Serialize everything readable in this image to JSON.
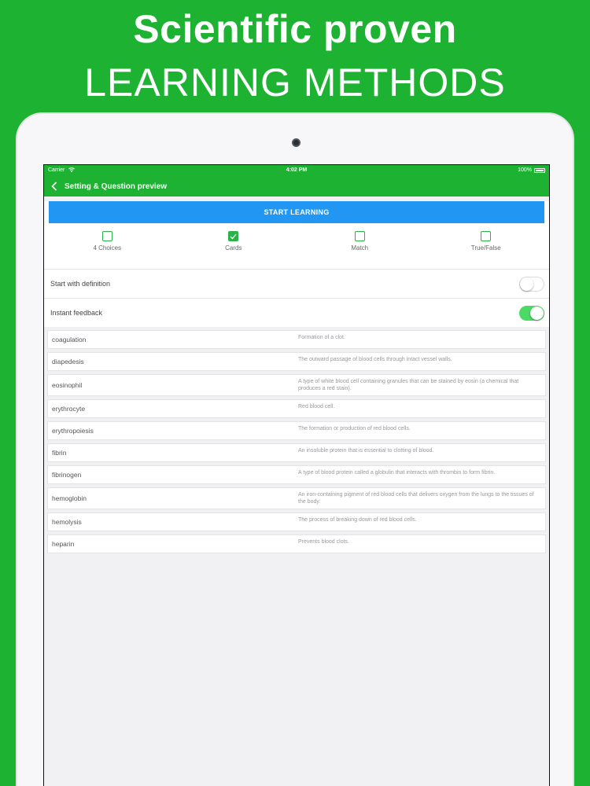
{
  "headline": {
    "line1": "Scientific proven",
    "line2": "LEARNING METHODS"
  },
  "status_bar": {
    "carrier": "Carrier",
    "time": "4:02 PM",
    "battery": "100%"
  },
  "nav": {
    "title": "Setting & Question preview"
  },
  "start_button": "START LEARNING",
  "modes": [
    {
      "label": "4 Choices",
      "checked": false
    },
    {
      "label": "Cards",
      "checked": true
    },
    {
      "label": "Match",
      "checked": false
    },
    {
      "label": "True/False",
      "checked": false
    }
  ],
  "settings": [
    {
      "label": "Start with definition",
      "on": false
    },
    {
      "label": "Instant feedback",
      "on": true
    }
  ],
  "terms": [
    {
      "term": "coagulation",
      "definition": "Formation of a clot."
    },
    {
      "term": "diapedesis",
      "definition": "The outward passage of blood cells through intact vessel walls."
    },
    {
      "term": "eosinophil",
      "definition": "A type of white blood cell containing granules that can be stained by eosin (a chemical that produces a red stain)."
    },
    {
      "term": "erythrocyte",
      "definition": "Red blood cell."
    },
    {
      "term": "erythropoiesis",
      "definition": "The formation or production of red blood cells."
    },
    {
      "term": "fibrin",
      "definition": "An insoluble protein that is essential to clotting of blood."
    },
    {
      "term": "fibrinogen",
      "definition": "A type of blood protein called a globulin that interacts with thrombin to form fibrin."
    },
    {
      "term": "hemoglobin",
      "definition": "An iron-containing pigment of red blood cells that delivers oxygen from the lungs to the tissues of the body."
    },
    {
      "term": "hemolysis",
      "definition": "The process of breaking down of red blood cells."
    },
    {
      "term": "heparin",
      "definition": "Prevents blood clots."
    }
  ],
  "colors": {
    "brand_green": "#1db232",
    "button_blue": "#2196f3",
    "toggle_on": "#4cd964"
  }
}
